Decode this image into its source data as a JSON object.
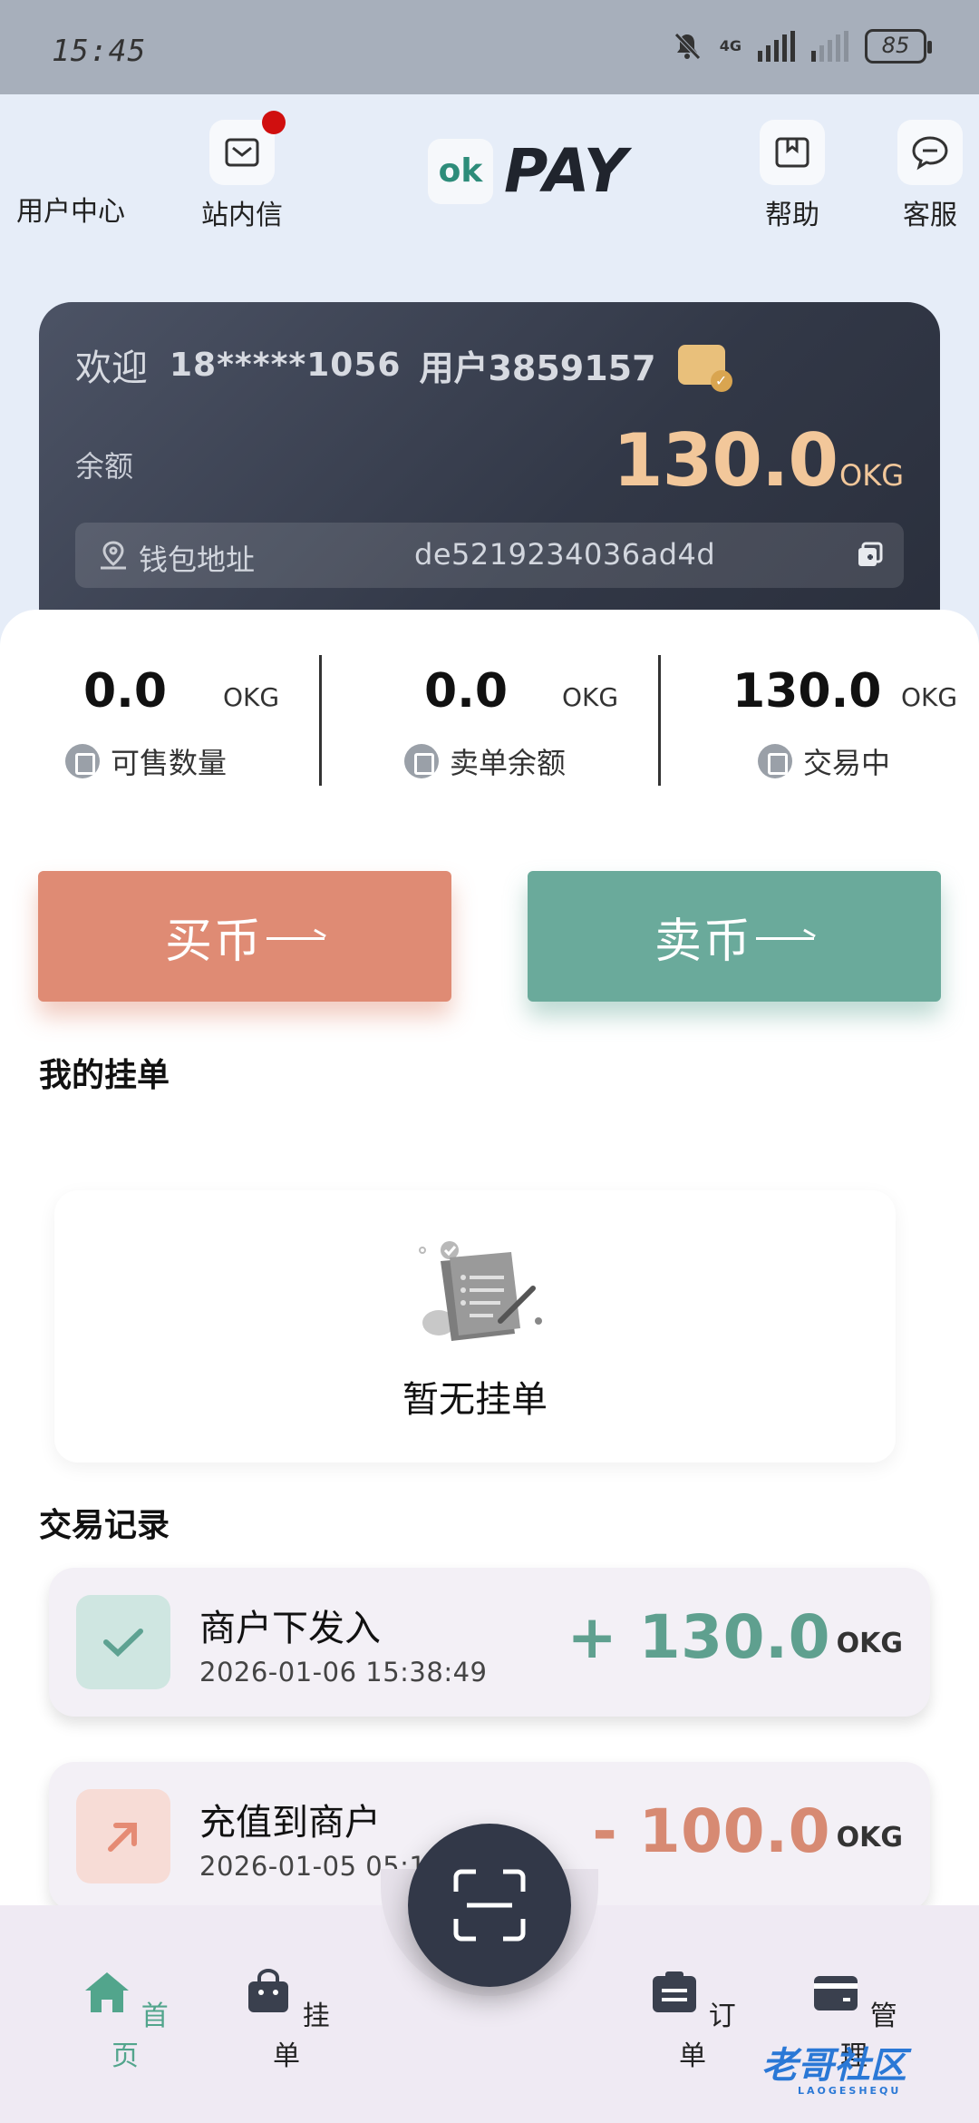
{
  "status_bar": {
    "time": "15:45",
    "network": "4G",
    "battery": "85"
  },
  "top_nav": {
    "user_center": "用户中心",
    "inbox": "站内信",
    "logo_text": "PAY",
    "logo_mark": "ok",
    "help": "帮助",
    "service": "客服"
  },
  "account_card": {
    "welcome": "欢迎",
    "phone": "18*****1056",
    "username": "用户3859157",
    "balance_label": "余额",
    "balance_value": "130.0",
    "balance_unit": "OKG",
    "wallet_label": "钱包地址",
    "wallet_address": "de5219234036ad4d"
  },
  "stats": [
    {
      "value": "0.0",
      "unit": "OKG",
      "label": "可售数量"
    },
    {
      "value": "0.0",
      "unit": "OKG",
      "label": "卖单余额"
    },
    {
      "value": "130.0",
      "unit": "OKG",
      "label": "交易中"
    }
  ],
  "actions": {
    "buy": "买币",
    "sell": "卖币"
  },
  "my_orders": {
    "title": "我的挂单",
    "empty_text": "暂无挂单"
  },
  "transactions": {
    "title": "交易记录",
    "items": [
      {
        "name": "商户下发入",
        "time": "2026-01-06 15:38:49",
        "amount": "+ 130.0",
        "unit": "OKG",
        "color": "#5fa08f"
      },
      {
        "name": "充值到商户",
        "time": "2026-01-05 05:1",
        "amount": "- 100.0",
        "unit": "OKG",
        "color": "#d78a73"
      }
    ]
  },
  "bottom_tabs": {
    "home": "首页",
    "orders_listed": "挂单",
    "orders": "订单",
    "manage": "管理"
  },
  "watermark": {
    "text": "老哥社区",
    "sub": "LAOGESHEQU"
  },
  "colors": {
    "accent_green": "#6aaa9b",
    "accent_orange": "#df8b74",
    "active_tab": "#52a58c"
  }
}
